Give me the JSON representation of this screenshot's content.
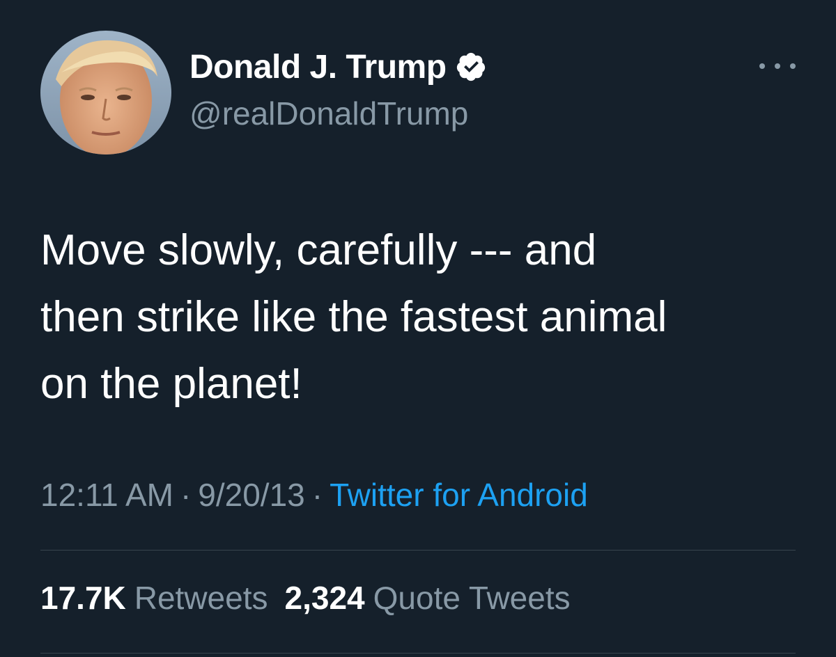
{
  "colors": {
    "background": "#15202b",
    "primary_text": "#ffffff",
    "secondary_text": "#8899a6",
    "link": "#1da1f2",
    "divider": "#38444d"
  },
  "author": {
    "display_name": "Donald J. Trump",
    "handle": "@realDonaldTrump",
    "verified_icon": "verified-badge-icon",
    "avatar_icon": "user-avatar"
  },
  "more_menu_icon": "more-horizontal-icon",
  "tweet": {
    "text_lines": [
      "Move slowly, carefully --- and",
      "then strike like the fastest animal",
      "on the planet!"
    ]
  },
  "meta": {
    "time": "12:11 AM",
    "separator": "·",
    "date": "9/20/13",
    "source": "Twitter for Android"
  },
  "stats": {
    "retweets_count": "17.7K",
    "retweets_label": "Retweets",
    "quotes_count": "2,324",
    "quotes_label": "Quote Tweets"
  }
}
